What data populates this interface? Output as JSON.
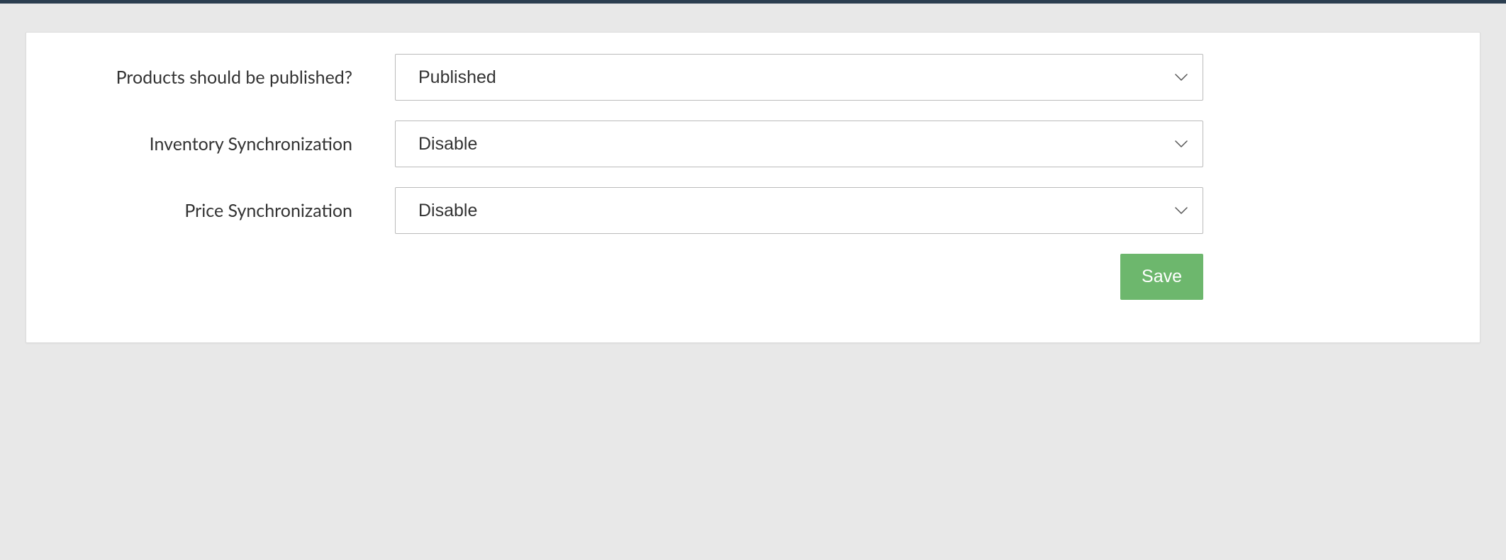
{
  "form": {
    "products_published": {
      "label": "Products should be published?",
      "value": "Published"
    },
    "inventory_sync": {
      "label": "Inventory Synchronization",
      "value": "Disable"
    },
    "price_sync": {
      "label": "Price Synchronization",
      "value": "Disable"
    },
    "save_label": "Save"
  }
}
